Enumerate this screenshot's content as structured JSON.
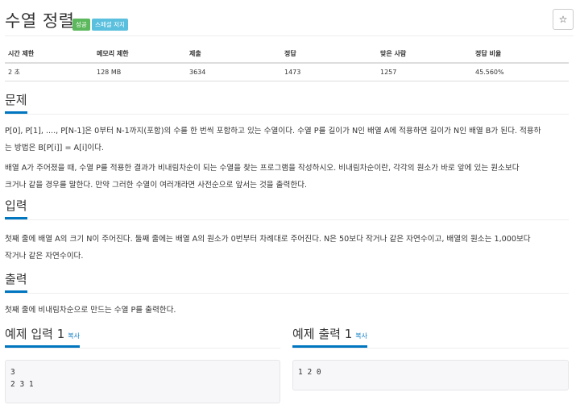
{
  "header": {
    "title": "수열 정렬",
    "badge_success": "성공",
    "badge_info": "스페셜 저지",
    "star_glyph": "☆"
  },
  "info_table": {
    "headers": [
      "시간 제한",
      "메모리 제한",
      "제출",
      "정답",
      "맞은 사람",
      "정답 비율"
    ],
    "row": [
      "2 초",
      "128 MB",
      "3634",
      "1473",
      "1257",
      "45.560%"
    ]
  },
  "problem": {
    "heading": "문제",
    "p1_line1": "P[0], P[1], ...., P[N-1]은 0부터 N-1까지(포함)의 수를 한 번씩 포함하고 있는 수열이다. 수열 P를 길이가 N인 배열 A에 적용하면 길이가 N인 배열 B가 된다. 적용하",
    "p1_line2": "는 방법은 B[P[i]] = A[i]이다.",
    "p2_line1": "배열 A가 주어졌을 때, 수열 P를 적용한 결과가 비내림차순이 되는 수열을 찾는 프로그램을 작성하시오. 비내림차순이란, 각각의 원소가 바로 앞에 있는 원소보다",
    "p2_line2": "크거나 같을 경우를 말한다. 만약 그러한 수열이 여러개라면 사전순으로 앞서는 것을 출력한다."
  },
  "input": {
    "heading": "입력",
    "line1": "첫째 줄에 배열 A의 크기 N이 주어진다. 둘째 줄에는 배열 A의 원소가 0번부터 차례대로 주어진다. N은 50보다 작거나 같은 자연수이고, 배열의 원소는 1,000보다",
    "line2": "작거나 같은 자연수이다."
  },
  "output": {
    "heading": "출력",
    "line1": "첫째 줄에 비내림차순으로 만드는 수열 P를 출력한다."
  },
  "sample_input": {
    "heading": "예제 입력 1",
    "copy": "복사",
    "content": "3\n2 3 1"
  },
  "sample_output": {
    "heading": "예제 출력 1",
    "copy": "복사",
    "content": "1 2 0"
  }
}
